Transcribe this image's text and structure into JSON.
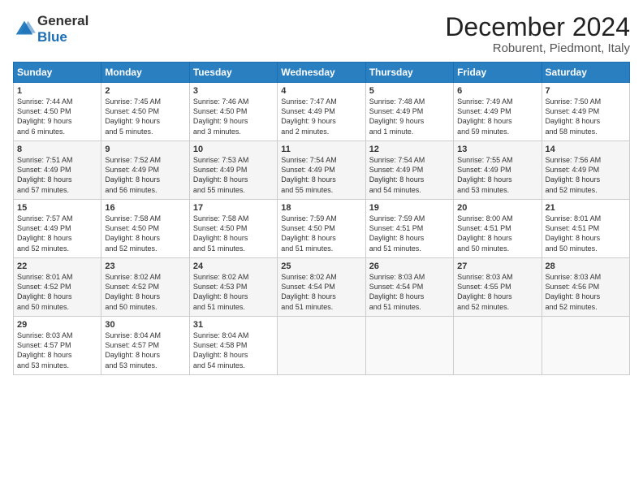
{
  "header": {
    "logo_general": "General",
    "logo_blue": "Blue",
    "title": "December 2024",
    "subtitle": "Roburent, Piedmont, Italy"
  },
  "days_of_week": [
    "Sunday",
    "Monday",
    "Tuesday",
    "Wednesday",
    "Thursday",
    "Friday",
    "Saturday"
  ],
  "weeks": [
    [
      {
        "day": 1,
        "lines": [
          "Sunrise: 7:44 AM",
          "Sunset: 4:50 PM",
          "Daylight: 9 hours",
          "and 6 minutes."
        ]
      },
      {
        "day": 2,
        "lines": [
          "Sunrise: 7:45 AM",
          "Sunset: 4:50 PM",
          "Daylight: 9 hours",
          "and 5 minutes."
        ]
      },
      {
        "day": 3,
        "lines": [
          "Sunrise: 7:46 AM",
          "Sunset: 4:50 PM",
          "Daylight: 9 hours",
          "and 3 minutes."
        ]
      },
      {
        "day": 4,
        "lines": [
          "Sunrise: 7:47 AM",
          "Sunset: 4:49 PM",
          "Daylight: 9 hours",
          "and 2 minutes."
        ]
      },
      {
        "day": 5,
        "lines": [
          "Sunrise: 7:48 AM",
          "Sunset: 4:49 PM",
          "Daylight: 9 hours",
          "and 1 minute."
        ]
      },
      {
        "day": 6,
        "lines": [
          "Sunrise: 7:49 AM",
          "Sunset: 4:49 PM",
          "Daylight: 8 hours",
          "and 59 minutes."
        ]
      },
      {
        "day": 7,
        "lines": [
          "Sunrise: 7:50 AM",
          "Sunset: 4:49 PM",
          "Daylight: 8 hours",
          "and 58 minutes."
        ]
      }
    ],
    [
      {
        "day": 8,
        "lines": [
          "Sunrise: 7:51 AM",
          "Sunset: 4:49 PM",
          "Daylight: 8 hours",
          "and 57 minutes."
        ]
      },
      {
        "day": 9,
        "lines": [
          "Sunrise: 7:52 AM",
          "Sunset: 4:49 PM",
          "Daylight: 8 hours",
          "and 56 minutes."
        ]
      },
      {
        "day": 10,
        "lines": [
          "Sunrise: 7:53 AM",
          "Sunset: 4:49 PM",
          "Daylight: 8 hours",
          "and 55 minutes."
        ]
      },
      {
        "day": 11,
        "lines": [
          "Sunrise: 7:54 AM",
          "Sunset: 4:49 PM",
          "Daylight: 8 hours",
          "and 55 minutes."
        ]
      },
      {
        "day": 12,
        "lines": [
          "Sunrise: 7:54 AM",
          "Sunset: 4:49 PM",
          "Daylight: 8 hours",
          "and 54 minutes."
        ]
      },
      {
        "day": 13,
        "lines": [
          "Sunrise: 7:55 AM",
          "Sunset: 4:49 PM",
          "Daylight: 8 hours",
          "and 53 minutes."
        ]
      },
      {
        "day": 14,
        "lines": [
          "Sunrise: 7:56 AM",
          "Sunset: 4:49 PM",
          "Daylight: 8 hours",
          "and 52 minutes."
        ]
      }
    ],
    [
      {
        "day": 15,
        "lines": [
          "Sunrise: 7:57 AM",
          "Sunset: 4:49 PM",
          "Daylight: 8 hours",
          "and 52 minutes."
        ]
      },
      {
        "day": 16,
        "lines": [
          "Sunrise: 7:58 AM",
          "Sunset: 4:50 PM",
          "Daylight: 8 hours",
          "and 52 minutes."
        ]
      },
      {
        "day": 17,
        "lines": [
          "Sunrise: 7:58 AM",
          "Sunset: 4:50 PM",
          "Daylight: 8 hours",
          "and 51 minutes."
        ]
      },
      {
        "day": 18,
        "lines": [
          "Sunrise: 7:59 AM",
          "Sunset: 4:50 PM",
          "Daylight: 8 hours",
          "and 51 minutes."
        ]
      },
      {
        "day": 19,
        "lines": [
          "Sunrise: 7:59 AM",
          "Sunset: 4:51 PM",
          "Daylight: 8 hours",
          "and 51 minutes."
        ]
      },
      {
        "day": 20,
        "lines": [
          "Sunrise: 8:00 AM",
          "Sunset: 4:51 PM",
          "Daylight: 8 hours",
          "and 50 minutes."
        ]
      },
      {
        "day": 21,
        "lines": [
          "Sunrise: 8:01 AM",
          "Sunset: 4:51 PM",
          "Daylight: 8 hours",
          "and 50 minutes."
        ]
      }
    ],
    [
      {
        "day": 22,
        "lines": [
          "Sunrise: 8:01 AM",
          "Sunset: 4:52 PM",
          "Daylight: 8 hours",
          "and 50 minutes."
        ]
      },
      {
        "day": 23,
        "lines": [
          "Sunrise: 8:02 AM",
          "Sunset: 4:52 PM",
          "Daylight: 8 hours",
          "and 50 minutes."
        ]
      },
      {
        "day": 24,
        "lines": [
          "Sunrise: 8:02 AM",
          "Sunset: 4:53 PM",
          "Daylight: 8 hours",
          "and 51 minutes."
        ]
      },
      {
        "day": 25,
        "lines": [
          "Sunrise: 8:02 AM",
          "Sunset: 4:54 PM",
          "Daylight: 8 hours",
          "and 51 minutes."
        ]
      },
      {
        "day": 26,
        "lines": [
          "Sunrise: 8:03 AM",
          "Sunset: 4:54 PM",
          "Daylight: 8 hours",
          "and 51 minutes."
        ]
      },
      {
        "day": 27,
        "lines": [
          "Sunrise: 8:03 AM",
          "Sunset: 4:55 PM",
          "Daylight: 8 hours",
          "and 52 minutes."
        ]
      },
      {
        "day": 28,
        "lines": [
          "Sunrise: 8:03 AM",
          "Sunset: 4:56 PM",
          "Daylight: 8 hours",
          "and 52 minutes."
        ]
      }
    ],
    [
      {
        "day": 29,
        "lines": [
          "Sunrise: 8:03 AM",
          "Sunset: 4:57 PM",
          "Daylight: 8 hours",
          "and 53 minutes."
        ]
      },
      {
        "day": 30,
        "lines": [
          "Sunrise: 8:04 AM",
          "Sunset: 4:57 PM",
          "Daylight: 8 hours",
          "and 53 minutes."
        ]
      },
      {
        "day": 31,
        "lines": [
          "Sunrise: 8:04 AM",
          "Sunset: 4:58 PM",
          "Daylight: 8 hours",
          "and 54 minutes."
        ]
      },
      null,
      null,
      null,
      null
    ]
  ]
}
